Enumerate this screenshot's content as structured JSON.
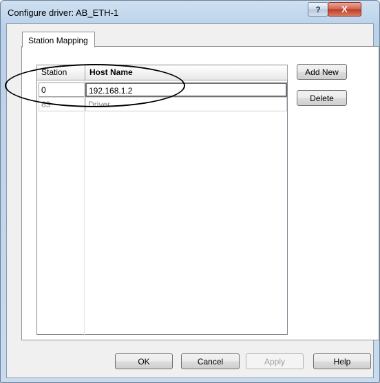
{
  "window": {
    "title": "Configure driver: AB_ETH-1",
    "help_glyph": "?",
    "close_glyph": "X"
  },
  "tabs": [
    {
      "label": "Station Mapping"
    }
  ],
  "grid": {
    "columns": [
      "Station",
      "Host Name"
    ],
    "rows": [
      {
        "station": "0",
        "host": "192.168.1.2"
      },
      {
        "station": "63",
        "host": "Driver"
      }
    ]
  },
  "side_buttons": {
    "add_new": "Add New",
    "delete": "Delete"
  },
  "bottom_buttons": {
    "ok": "OK",
    "cancel": "Cancel",
    "apply": "Apply",
    "help": "Help"
  }
}
